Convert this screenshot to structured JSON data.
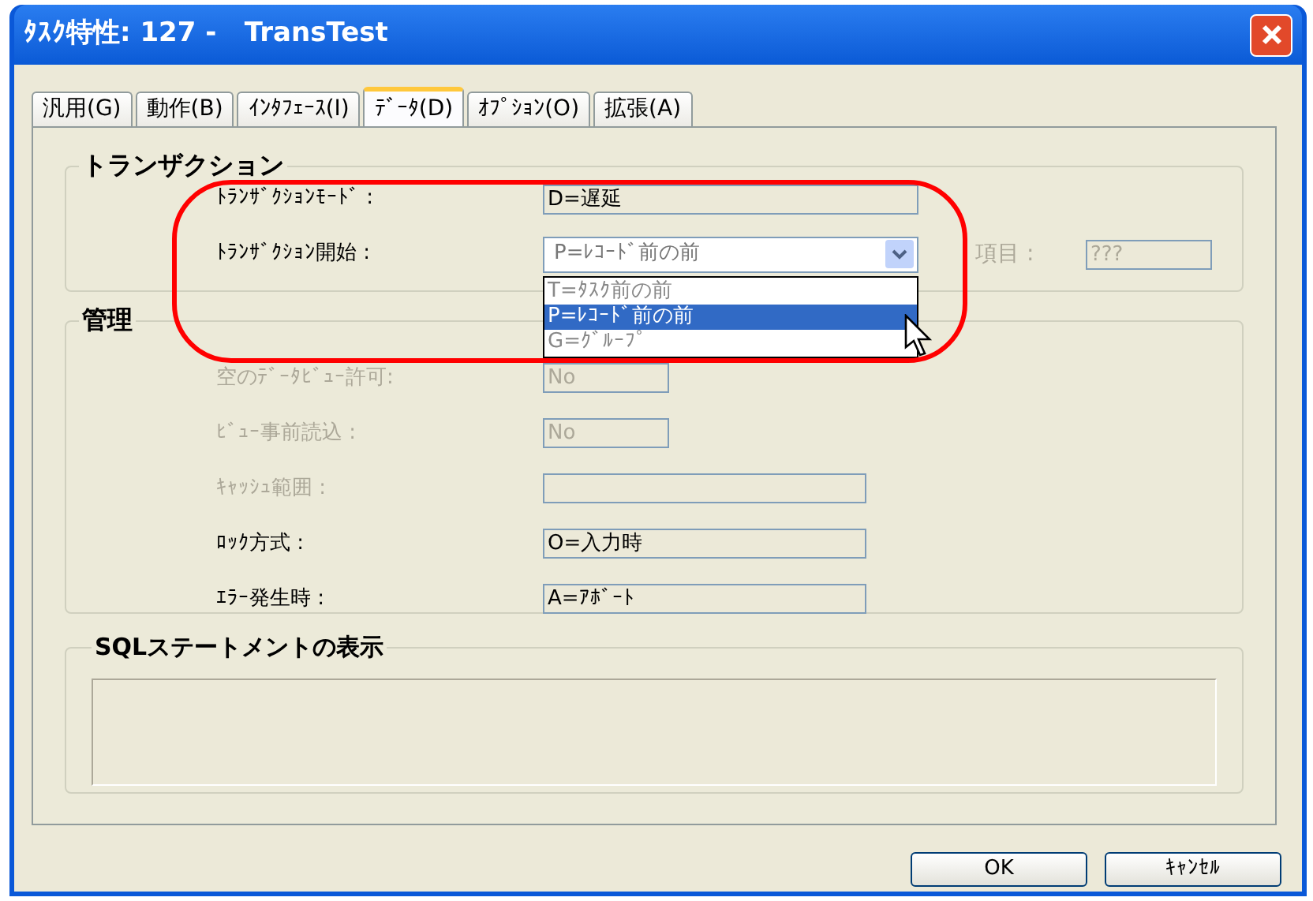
{
  "window": {
    "title": "ﾀｽｸ特性: 127 -   TransTest"
  },
  "tabs": [
    {
      "label": "汎用(G)",
      "selected": false
    },
    {
      "label": "動作(B)",
      "selected": false
    },
    {
      "label": "ｲﾝﾀﾌｪｰｽ(I)",
      "selected": false
    },
    {
      "label": "ﾃﾞｰﾀ(D)",
      "selected": true
    },
    {
      "label": "ｵﾌﾟｼｮﾝ(O)",
      "selected": false
    },
    {
      "label": "拡張(A)",
      "selected": false
    }
  ],
  "transaction": {
    "title": "トランザクション",
    "mode": {
      "label": "ﾄﾗﾝｻﾞｸｼｮﾝﾓｰﾄﾞ :",
      "value": "D=遅延"
    },
    "start": {
      "label": "ﾄﾗﾝｻﾞｸｼｮﾝ開始 :",
      "value": "P=ﾚｺｰﾄﾞ前の前",
      "expanded": true,
      "options": [
        {
          "label": "T=ﾀｽｸ前の前",
          "selected": false
        },
        {
          "label": "P=ﾚｺｰﾄﾞ前の前",
          "selected": true
        },
        {
          "label": "G=ｸﾞﾙｰﾌﾟ",
          "selected": false
        }
      ]
    },
    "item": {
      "label": "項目 :",
      "value": "???",
      "disabled": true
    }
  },
  "management": {
    "title": "管理",
    "rows": [
      {
        "label": "空のﾃﾞｰﾀﾋﾞｭｰ許可:",
        "value": "No",
        "kind": "short",
        "disabled": true
      },
      {
        "label": "ﾋﾞｭｰ事前読込 :",
        "value": "No",
        "kind": "short",
        "disabled": true
      },
      {
        "label": "ｷｬｯｼｭ範囲 :",
        "kind": "long",
        "disabled": true
      },
      {
        "label": "ﾛｯｸ方式 :",
        "value": "O=入力時",
        "kind": "long",
        "disabled": false
      },
      {
        "label": "ｴﾗｰ発生時 :",
        "value": "A=ｱﾎﾞｰﾄ",
        "kind": "long",
        "disabled": false
      }
    ]
  },
  "sql": {
    "title": "SQLステートメントの表示"
  },
  "buttons": [
    "OK",
    "ｷｬﾝｾﾙ"
  ]
}
